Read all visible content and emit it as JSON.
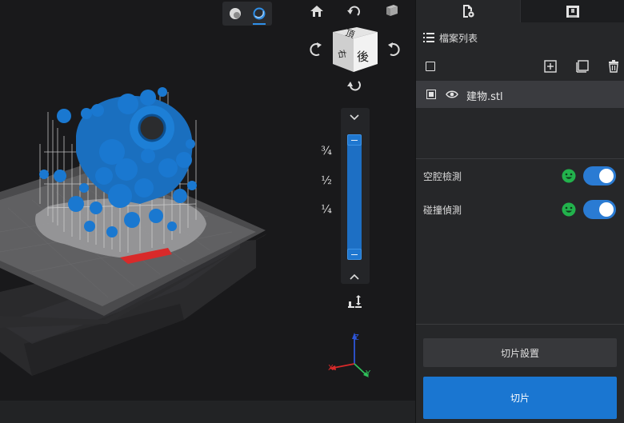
{
  "viewport": {
    "render_modes": [
      "solid-shading-icon",
      "xray-shading-icon"
    ],
    "active_render_mode": 1,
    "view_cube": {
      "top_face": "頂",
      "front_face": "後",
      "side_face": "右"
    },
    "layer_slider": {
      "tick_labels": [
        "¾",
        "½",
        "¼"
      ],
      "upper_value": 1,
      "lower_value": 0
    },
    "axes": {
      "x": "X",
      "y": "Y",
      "z": "Z"
    },
    "colors": {
      "model": "#1a78d0",
      "support": "#c8c8c8",
      "collision": "#d82a2a",
      "bed": "#5a5a5a",
      "accent": "#2f8fe8"
    }
  },
  "panel": {
    "tabs": [
      {
        "name": "file-settings-tab",
        "icon": "file-gear-icon"
      },
      {
        "name": "printer-tab",
        "icon": "printer-icon"
      }
    ],
    "file_list": {
      "title": "檔案列表",
      "files": [
        {
          "name": "建物.stl",
          "selected": true,
          "visible": true
        }
      ]
    },
    "checks": [
      {
        "label": "空腔檢測",
        "status": "ok",
        "enabled": true
      },
      {
        "label": "碰撞偵測",
        "status": "ok",
        "enabled": true
      }
    ],
    "settings_button": "切片設置",
    "slice_button": "切片",
    "colors": {
      "ok": "#22b24c",
      "toggle_on": "#2a7bd3",
      "primary": "#1a76d1"
    }
  }
}
